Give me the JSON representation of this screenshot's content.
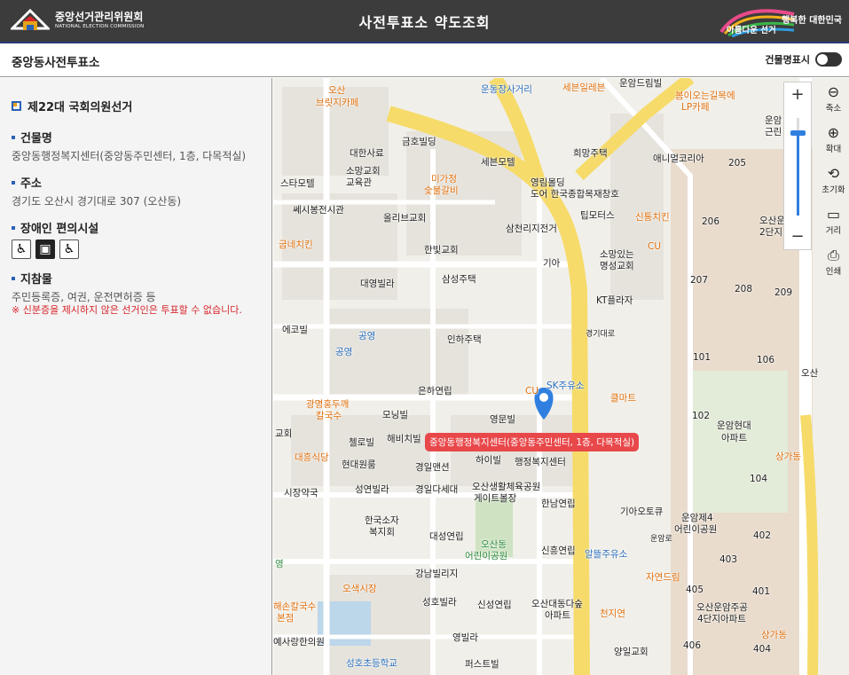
{
  "header": {
    "org_ko": "중앙선거관리위원회",
    "org_en": "NATIONAL ELECTION COMMISSION",
    "title": "사전투표소 약도조회",
    "slogan_right": "행복한 대한민국",
    "slogan_left": "아름다운 선거"
  },
  "subbar": {
    "place": "중앙동사전투표소",
    "toggle_label": "건물명표시"
  },
  "sidebar": {
    "election": "제22대 국회의원선거",
    "building_head": "건물명",
    "building_value": "중앙동행정복지센터(중앙동주민센터, 1층, 다목적실)",
    "address_head": "주소",
    "address_value": "경기도 오산시 경기대로 307 (오산동)",
    "facility_head": "장애인 편의시설",
    "facility_icons": [
      "wheelchair-icon",
      "elevator-icon",
      "accessible-toilet-icon"
    ],
    "docs_head": "지참물",
    "docs_value": "주민등록증, 여권, 운전면허증 등",
    "docs_warning": "※ 신분증을 제시하지 않은 선거인은 투표할 수 없습니다."
  },
  "map": {
    "zoom_in": "+",
    "zoom_out": "−",
    "zoom_level_fraction": 0.84,
    "tools": {
      "shrink": "축소",
      "enlarge": "확대",
      "reset": "초기화",
      "distance": "거리",
      "print": "인쇄"
    },
    "pin_label": "중앙동행정복지센터(중앙동주민센터, 1층, 다목적실)",
    "labels": [
      {
        "t": "오산",
        "c": "o"
      },
      {
        "t": "브릿지카페",
        "c": "o"
      },
      {
        "t": "운동장사거리",
        "c": "b"
      },
      {
        "t": "세븐일레븐",
        "c": "o"
      },
      {
        "t": "운암드림빌",
        "c": ""
      },
      {
        "t": "봄이오는길목에",
        "c": "o"
      },
      {
        "t": "LP카페",
        "c": "o"
      },
      {
        "t": "운암",
        "c": ""
      },
      {
        "t": "근린",
        "c": ""
      },
      {
        "t": "금호빌딩",
        "c": ""
      },
      {
        "t": "대한사료",
        "c": ""
      },
      {
        "t": "세븐모텔",
        "c": ""
      },
      {
        "t": "희망주택",
        "c": ""
      },
      {
        "t": "애니멀코리아",
        "c": ""
      },
      {
        "t": "205",
        "c": ""
      },
      {
        "t": "소망교회",
        "c": ""
      },
      {
        "t": "교육관",
        "c": ""
      },
      {
        "t": "스타모텔",
        "c": ""
      },
      {
        "t": "미가정",
        "c": "o"
      },
      {
        "t": "숯불갈비",
        "c": "o"
      },
      {
        "t": "영림몰딩",
        "c": ""
      },
      {
        "t": "도어 한국종합목재창호",
        "c": ""
      },
      {
        "t": "쎄시봉전시관",
        "c": ""
      },
      {
        "t": "올리브교회",
        "c": ""
      },
      {
        "t": "팁모터스",
        "c": ""
      },
      {
        "t": "신통치킨",
        "c": "o"
      },
      {
        "t": "206",
        "c": ""
      },
      {
        "t": "오산운",
        "c": ""
      },
      {
        "t": "2단지",
        "c": ""
      },
      {
        "t": "삼천리지전거",
        "c": ""
      },
      {
        "t": "굽네치킨",
        "c": "o"
      },
      {
        "t": "한빛교회",
        "c": ""
      },
      {
        "t": "소망있는",
        "c": ""
      },
      {
        "t": "명성교회",
        "c": ""
      },
      {
        "t": "CU",
        "c": "o"
      },
      {
        "t": "기아",
        "c": ""
      },
      {
        "t": "207",
        "c": ""
      },
      {
        "t": "208",
        "c": ""
      },
      {
        "t": "209",
        "c": ""
      },
      {
        "t": "대영빌라",
        "c": ""
      },
      {
        "t": "삼성주택",
        "c": ""
      },
      {
        "t": "KT플라자",
        "c": ""
      },
      {
        "t": "에코빌",
        "c": ""
      },
      {
        "t": "공영",
        "c": "b"
      },
      {
        "t": "공영",
        "c": "b"
      },
      {
        "t": "인하주택",
        "c": ""
      },
      {
        "t": "경기대로",
        "c": ""
      },
      {
        "t": "101",
        "c": ""
      },
      {
        "t": "106",
        "c": ""
      },
      {
        "t": "오산",
        "c": ""
      },
      {
        "t": "은하연립",
        "c": ""
      },
      {
        "t": "CU",
        "c": "o"
      },
      {
        "t": "SK주유소",
        "c": "b"
      },
      {
        "t": "클마트",
        "c": "o"
      },
      {
        "t": "광명홍두깨",
        "c": "o"
      },
      {
        "t": "칼국수",
        "c": "o"
      },
      {
        "t": "모닝빌",
        "c": ""
      },
      {
        "t": "영문빌",
        "c": ""
      },
      {
        "t": "102",
        "c": ""
      },
      {
        "t": "운암현대",
        "c": ""
      },
      {
        "t": "아파트",
        "c": ""
      },
      {
        "t": "교회",
        "c": ""
      },
      {
        "t": "첼로빌",
        "c": ""
      },
      {
        "t": "해비치빌",
        "c": ""
      },
      {
        "t": "대흥식당",
        "c": "o"
      },
      {
        "t": "현대원룸",
        "c": ""
      },
      {
        "t": "경일맨션",
        "c": ""
      },
      {
        "t": "하이빌",
        "c": ""
      },
      {
        "t": "행정복지센터",
        "c": ""
      },
      {
        "t": "상가동",
        "c": "o"
      },
      {
        "t": "104",
        "c": ""
      },
      {
        "t": "시장약국",
        "c": ""
      },
      {
        "t": "성연빌라",
        "c": ""
      },
      {
        "t": "경일다세대",
        "c": ""
      },
      {
        "t": "오산생활체육공원",
        "c": ""
      },
      {
        "t": "게이트볼장",
        "c": ""
      },
      {
        "t": "한남연립",
        "c": ""
      },
      {
        "t": "기아오토큐",
        "c": ""
      },
      {
        "t": "운암제4",
        "c": "g"
      },
      {
        "t": "어린이공원",
        "c": "g"
      },
      {
        "t": "한국소자",
        "c": ""
      },
      {
        "t": "복지회",
        "c": ""
      },
      {
        "t": "대성연립",
        "c": ""
      },
      {
        "t": "오산동",
        "c": "g"
      },
      {
        "t": "어린이공원",
        "c": "g"
      },
      {
        "t": "신흥연립",
        "c": ""
      },
      {
        "t": "알뜰주유소",
        "c": "b"
      },
      {
        "t": "운암로",
        "c": ""
      },
      {
        "t": "402",
        "c": ""
      },
      {
        "t": "403",
        "c": ""
      },
      {
        "t": "영",
        "c": "g"
      },
      {
        "t": "강남빌리지",
        "c": ""
      },
      {
        "t": "자연드림",
        "c": "o"
      },
      {
        "t": "오색시장",
        "c": "o"
      },
      {
        "t": "405",
        "c": ""
      },
      {
        "t": "401",
        "c": ""
      },
      {
        "t": "해손칼국수",
        "c": "o"
      },
      {
        "t": "본점",
        "c": "o"
      },
      {
        "t": "성호빌라",
        "c": ""
      },
      {
        "t": "신성연립",
        "c": ""
      },
      {
        "t": "오산대동다숲",
        "c": ""
      },
      {
        "t": "아파트",
        "c": ""
      },
      {
        "t": "천지연",
        "c": "o"
      },
      {
        "t": "오산운암주공",
        "c": ""
      },
      {
        "t": "4단지아파트",
        "c": ""
      },
      {
        "t": "예사랑한의원",
        "c": ""
      },
      {
        "t": "영빌라",
        "c": ""
      },
      {
        "t": "상가동",
        "c": "o"
      },
      {
        "t": "406",
        "c": ""
      },
      {
        "t": "404",
        "c": ""
      },
      {
        "t": "성호초등학교",
        "c": "b"
      },
      {
        "t": "퍼스트빌",
        "c": ""
      },
      {
        "t": "양일교회",
        "c": ""
      }
    ]
  },
  "colors": {
    "header_bg": "#3c3c3c",
    "sidebar_bg": "#f4f4f4",
    "main_road": "#f6db6a",
    "pin": "#2f7fe0",
    "pin_label_bg": "#e8484a",
    "warning": "#d6262c"
  }
}
